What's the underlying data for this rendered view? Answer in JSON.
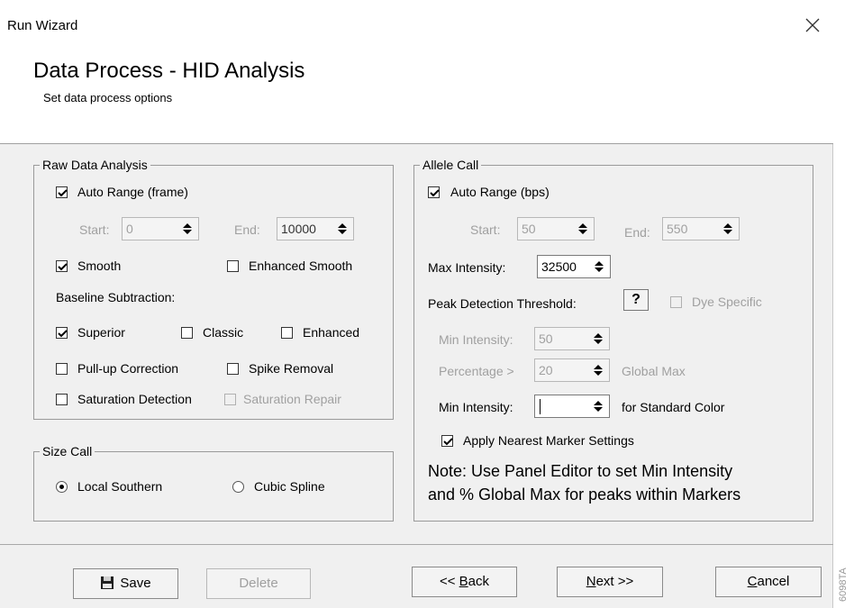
{
  "window": {
    "title": "Run Wizard"
  },
  "header": {
    "title": "Data Process - HID Analysis",
    "subtitle": "Set data process options"
  },
  "raw_data_analysis": {
    "legend": "Raw Data Analysis",
    "auto_range": {
      "label": "Auto Range (frame)",
      "checked": true
    },
    "start": {
      "label": "Start:",
      "value": "0"
    },
    "end": {
      "label": "End:",
      "value": "10000"
    },
    "smooth": {
      "label": "Smooth",
      "checked": true
    },
    "enhanced_smooth": {
      "label": "Enhanced Smooth",
      "checked": false
    },
    "baseline_label": "Baseline Subtraction:",
    "superior": {
      "label": "Superior",
      "checked": true
    },
    "classic": {
      "label": "Classic",
      "checked": false
    },
    "enhanced": {
      "label": "Enhanced",
      "checked": false
    },
    "pullup": {
      "label": "Pull-up Correction",
      "checked": false
    },
    "spike": {
      "label": "Spike Removal",
      "checked": false
    },
    "saturation_detection": {
      "label": "Saturation Detection",
      "checked": false
    },
    "saturation_repair": {
      "label": "Saturation Repair",
      "checked": false
    }
  },
  "size_call": {
    "legend": "Size Call",
    "local_southern": {
      "label": "Local Southern",
      "selected": true
    },
    "cubic_spline": {
      "label": "Cubic Spline",
      "selected": false
    }
  },
  "allele_call": {
    "legend": "Allele Call",
    "auto_range": {
      "label": "Auto Range (bps)",
      "checked": true
    },
    "start": {
      "label": "Start:",
      "value": "50"
    },
    "end": {
      "label": "End:",
      "value": "550"
    },
    "max_intensity": {
      "label": "Max Intensity:",
      "value": "32500"
    },
    "peak_detection": {
      "label": "Peak Detection Threshold:",
      "help": "?"
    },
    "dye_specific": {
      "label": "Dye Specific",
      "checked": false
    },
    "min_intensity_dis": {
      "label": "Min Intensity:",
      "value": "50"
    },
    "percentage": {
      "label": "Percentage >",
      "value": "20",
      "suffix": "Global Max"
    },
    "min_intensity_std": {
      "label": "Min Intensity:",
      "value": "",
      "suffix": "for Standard Color"
    },
    "apply_nearest": {
      "label": "Apply Nearest Marker Settings",
      "checked": true
    },
    "note_line1": "Note: Use Panel Editor to set Min Intensity",
    "note_line2": "and % Global Max for peaks within Markers"
  },
  "footer": {
    "save": "Save",
    "delete": "Delete",
    "back_prefix": "<< ",
    "back_mnemonic": "B",
    "back_rest": "ack",
    "next_mnemonic": "N",
    "next_rest": "ext >>",
    "cancel_mnemonic": "C",
    "cancel_rest": "ancel"
  },
  "side_code": "6098TA"
}
